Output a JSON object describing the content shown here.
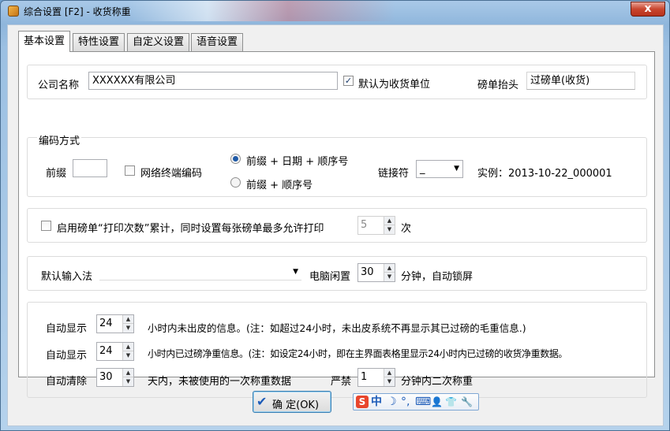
{
  "window": {
    "title": "综合设置 [F2] - 收货称重",
    "close_symbol": "x"
  },
  "tabs": [
    "基本设置",
    "特性设置",
    "自定义设置",
    "语音设置"
  ],
  "company": {
    "label": "公司名称",
    "value": "XXXXXX有限公司",
    "default_receiver_label": "默认为收货单位",
    "default_receiver_checked": true,
    "header_label": "磅单抬头",
    "header_value": "过磅单(收货)"
  },
  "coding": {
    "legend": "编码方式",
    "prefix_label": "前缀",
    "prefix_value": "",
    "network_label": "网络终端编码",
    "network_checked": false,
    "option1": "前缀 + 日期 + 顺序号",
    "option2": "前缀 + 顺序号",
    "selected_option": 1,
    "connector_label": "链接符",
    "connector_value": "_",
    "example": "实例：2013-10-22_000001"
  },
  "print_limit": {
    "label": "启用磅单“打印次数”累计，同时设置每张磅单最多允许打印",
    "checked": false,
    "value": "5",
    "unit": "次"
  },
  "input": {
    "method_label": "默认输入法",
    "method_value": "",
    "idle_label": "电脑闲置",
    "idle_value": "30",
    "idle_suffix": "分钟，自动锁屏"
  },
  "auto": {
    "show_label_1": "自动显示",
    "show_value_1": "24",
    "show_desc_1": "小时内未出皮的信息。(注：如超过24小时，未出皮系统不再显示其已过磅的毛重信息.)",
    "show_label_2": "自动显示",
    "show_value_2": "24",
    "show_desc_2": "小时内已过磅净重信息。(注：如设定24小时，即在主界面表格里显示24小时内已过磅的收货净重数据。",
    "clear_label": "自动清除",
    "clear_value": "30",
    "clear_desc": "天内，未被使用的一次称重数据",
    "forbid_label": "严禁",
    "forbid_value": "1",
    "forbid_desc": "分钟内二次称重"
  },
  "buttons": {
    "ok": "确 定(OK)"
  },
  "ime_bar": {
    "items": [
      "S",
      "中",
      "☽",
      "°,",
      "⌨",
      "👤",
      "👕",
      "🔧"
    ]
  },
  "colors": {
    "accent": "#1f5aa7",
    "close": "#c9462f",
    "ok_border": "#3c7fb1"
  }
}
